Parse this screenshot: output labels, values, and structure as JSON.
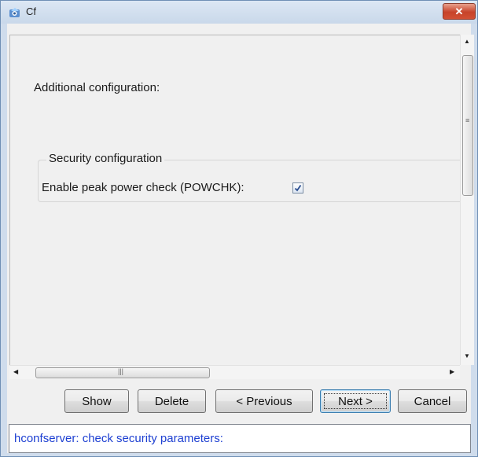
{
  "window": {
    "title": "Cf"
  },
  "content": {
    "heading": "Additional configuration:",
    "security": {
      "legend": "Security configuration",
      "peak_power_label": "Enable peak power check (POWCHK):",
      "peak_power_checked": true
    }
  },
  "buttons": {
    "show": "Show",
    "delete": "Delete",
    "previous": "< Previous",
    "next": "Next >",
    "cancel": "Cancel"
  },
  "status": {
    "message": "hconfserver: check security parameters:"
  }
}
